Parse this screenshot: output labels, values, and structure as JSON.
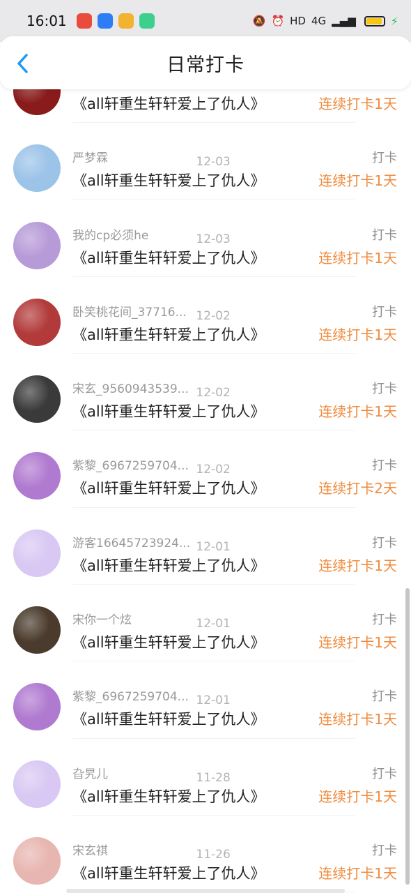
{
  "status_bar": {
    "time": "16:01",
    "apps": [
      {
        "icon": "baidu-app-icon",
        "color": "#e94b3c"
      },
      {
        "icon": "browser-app-icon",
        "color": "#2f7df6"
      },
      {
        "icon": "wallet-app-icon",
        "color": "#f3b230"
      },
      {
        "icon": "green-app-icon",
        "color": "#3ccf8e"
      }
    ],
    "network": "HD",
    "signal": "4G"
  },
  "header": {
    "title": "日常打卡",
    "back_icon": "chevron-left-icon",
    "accent": "#1a9cf3"
  },
  "list": {
    "checkin_label": "打卡",
    "items": [
      {
        "user": "",
        "date": "",
        "book": "《all轩重生轩轩爱上了仇人》",
        "streak": "连续打卡1天",
        "avatar_color": "#8a1b1b"
      },
      {
        "user": "严梦霖",
        "date": "12-03",
        "book": "《all轩重生轩轩爱上了仇人》",
        "streak": "连续打卡1天",
        "avatar_color": "#9cc3e8"
      },
      {
        "user": "我的cp必须he",
        "date": "12-03",
        "book": "《all轩重生轩轩爱上了仇人》",
        "streak": "连续打卡1天",
        "avatar_color": "#b79ad8"
      },
      {
        "user": "卧笑桃花间_37716...",
        "date": "12-02",
        "book": "《all轩重生轩轩爱上了仇人》",
        "streak": "连续打卡1天",
        "avatar_color": "#b23a3a"
      },
      {
        "user": "宋玄_9560943539...",
        "date": "12-02",
        "book": "《all轩重生轩轩爱上了仇人》",
        "streak": "连续打卡1天",
        "avatar_color": "#3a3a3a"
      },
      {
        "user": "紫黎_6967259704...",
        "date": "12-02",
        "book": "《all轩重生轩轩爱上了仇人》",
        "streak": "连续打卡2天",
        "avatar_color": "#b07ad0"
      },
      {
        "user": "游客16645723924...",
        "date": "12-01",
        "book": "《all轩重生轩轩爱上了仇人》",
        "streak": "连续打卡1天",
        "avatar_color": "#d9c8f3"
      },
      {
        "user": "宋你一个炫",
        "date": "12-01",
        "book": "《all轩重生轩轩爱上了仇人》",
        "streak": "连续打卡1天",
        "avatar_color": "#4a3b2c"
      },
      {
        "user": "紫黎_6967259704...",
        "date": "12-01",
        "book": "《all轩重生轩轩爱上了仇人》",
        "streak": "连续打卡1天",
        "avatar_color": "#b07ad0"
      },
      {
        "user": "旮旯儿",
        "date": "11-28",
        "book": "《all轩重生轩轩爱上了仇人》",
        "streak": "连续打卡1天",
        "avatar_color": "#d9c8f3"
      },
      {
        "user": "宋玄祺",
        "date": "11-26",
        "book": "《all轩重生轩轩爱上了仇人》",
        "streak": "连续打卡1天",
        "avatar_color": "#e8b6b0"
      }
    ]
  }
}
